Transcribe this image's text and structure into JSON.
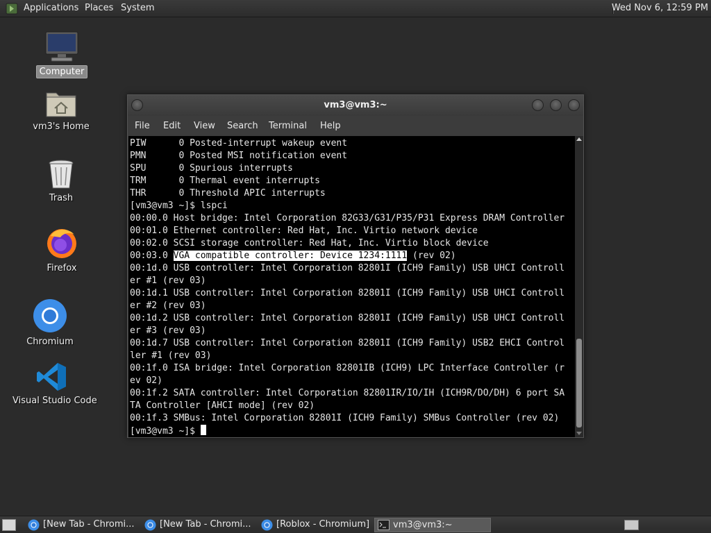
{
  "top_panel": {
    "menus": [
      "Applications",
      "Places",
      "System"
    ],
    "clock": "Wed Nov  6, 12:59 PM"
  },
  "desktop_icons": [
    {
      "label": "Computer",
      "icon": "computer-icon",
      "selected": true
    },
    {
      "label": "vm3's Home",
      "icon": "home-folder-icon"
    },
    {
      "label": "Trash",
      "icon": "trash-icon"
    },
    {
      "label": "Firefox",
      "icon": "firefox-icon"
    },
    {
      "label": "Chromium",
      "icon": "chromium-icon"
    },
    {
      "label": "Visual Studio Code",
      "icon": "vscode-icon"
    }
  ],
  "terminal": {
    "title": "vm3@vm3:~",
    "menu": [
      "File",
      "Edit",
      "View",
      "Search",
      "Terminal",
      "Help"
    ],
    "lines": [
      "PIW      0 Posted-interrupt wakeup event",
      "PMN      0 Posted MSI notification event",
      "SPU      0 Spurious interrupts",
      "TRM      0 Thermal event interrupts",
      "THR      0 Threshold APIC interrupts",
      "[vm3@vm3 ~]$ lspci",
      "00:00.0 Host bridge: Intel Corporation 82G33/G31/P35/P31 Express DRAM Controller",
      "00:01.0 Ethernet controller: Red Hat, Inc. Virtio network device",
      "00:02.0 SCSI storage controller: Red Hat, Inc. Virtio block device",
      "00:03.0 ",
      "00:1d.0 USB controller: Intel Corporation 82801I (ICH9 Family) USB UHCI Controll",
      "er #1 (rev 03)",
      "00:1d.1 USB controller: Intel Corporation 82801I (ICH9 Family) USB UHCI Controll",
      "er #2 (rev 03)",
      "00:1d.2 USB controller: Intel Corporation 82801I (ICH9 Family) USB UHCI Controll",
      "er #3 (rev 03)",
      "00:1d.7 USB controller: Intel Corporation 82801I (ICH9 Family) USB2 EHCI Control",
      "ler #1 (rev 03)",
      "00:1f.0 ISA bridge: Intel Corporation 82801IB (ICH9) LPC Interface Controller (r",
      "ev 02)",
      "00:1f.2 SATA controller: Intel Corporation 82801IR/IO/IH (ICH9R/DO/DH) 6 port SA",
      "TA Controller [AHCI mode] (rev 02)",
      "00:1f.3 SMBus: Intel Corporation 82801I (ICH9 Family) SMBus Controller (rev 02)",
      "[vm3@vm3 ~]$ "
    ],
    "highlighted_text": "VGA compatible controller: Device 1234:1111",
    "after_highlight": " (rev 02)",
    "highlight_line_index": 9,
    "prompt_line_index": 23
  },
  "taskbar": {
    "tasks": [
      {
        "label": "[New Tab - Chromi...",
        "icon": "chromium-icon",
        "active": false
      },
      {
        "label": "[New Tab - Chromi...",
        "icon": "chromium-icon",
        "active": false
      },
      {
        "label": "[Roblox - Chromium]",
        "icon": "chromium-icon",
        "active": false
      },
      {
        "label": "vm3@vm3:~",
        "icon": "terminal-icon",
        "active": true
      }
    ]
  }
}
